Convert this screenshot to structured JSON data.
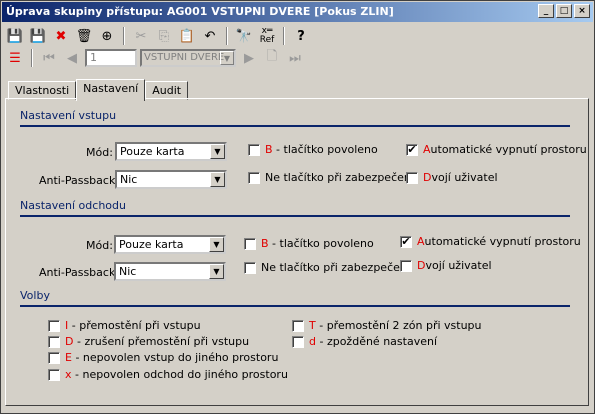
{
  "window": {
    "title": "Úprava skupiny přístupu: AG001 VSTUPNI DVERE [Pokus ZLIN]"
  },
  "nav": {
    "record": "1",
    "door": "VSTUPNI DVERE"
  },
  "tabs": [
    "Vlastnosti",
    "Nastavení",
    "Audit"
  ],
  "vstup": {
    "section": "Nastavení vstupu",
    "mod_label": "Mód:",
    "mod_value": "Pouze karta",
    "ap_label": "Anti-Passback:",
    "ap_value": "Nic",
    "b_key": "B",
    "b_text": " - tlačítko povoleno",
    "ne_text": "Ne tlačítko při zabezpečení",
    "auto_key": "A",
    "auto_text": "utomatické vypnutí prostoru",
    "d_key": "D",
    "d_text": "vojí uživatel"
  },
  "odchod": {
    "section": "Nastavení odchodu",
    "mod_label": "Mód:",
    "mod_value": "Pouze karta",
    "ap_label": "Anti-Passback:",
    "ap_value": "Nic",
    "b_key": "B",
    "b_text": " - tlačítko povoleno",
    "ne_text": "Ne tlačítko při zabezpečení",
    "auto_key": "A",
    "auto_text": "utomatické vypnutí prostoru",
    "d_key": "D",
    "d_text": "vojí uživatel"
  },
  "volby": {
    "section": "Volby",
    "items": [
      {
        "key": "I",
        "text": " - přemostění při vstupu"
      },
      {
        "key": "D",
        "text": " - zrušení přemostění při vstupu"
      },
      {
        "key": "E",
        "text": " - nepovolen vstup do jiného prostoru"
      },
      {
        "key": "x",
        "text": " - nepovolen odchod do jiného prostoru"
      },
      {
        "key": "T",
        "text": " - přemostění 2 zón při vstupu"
      },
      {
        "key": "d",
        "text": " - zpožděné nastavení"
      }
    ]
  },
  "checks": {
    "vstup_auto": true,
    "odchod_auto": true
  }
}
